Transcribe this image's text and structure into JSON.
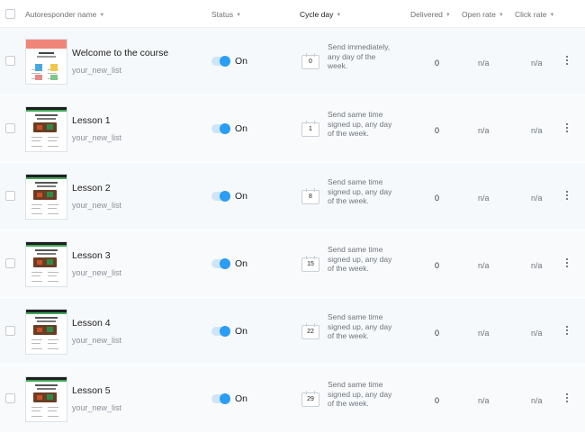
{
  "columns": {
    "name": "Autoresponder name",
    "status": "Status",
    "cycle_day": "Cycle day",
    "delivered": "Delivered",
    "open_rate": "Open rate",
    "click_rate": "Click rate"
  },
  "rows": [
    {
      "name": "Welcome to the course",
      "list": "your_new_list",
      "status": "On",
      "day": "0",
      "description": "Send immediately, any day of the week.",
      "delivered": "0",
      "open_rate": "n/a",
      "click_rate": "n/a"
    },
    {
      "name": "Lesson 1",
      "list": "your_new_list",
      "status": "On",
      "day": "1",
      "description": "Send same time signed up, any day of the week.",
      "delivered": "0",
      "open_rate": "n/a",
      "click_rate": "n/a"
    },
    {
      "name": "Lesson 2",
      "list": "your_new_list",
      "status": "On",
      "day": "8",
      "description": "Send same time signed up, any day of the week.",
      "delivered": "0",
      "open_rate": "n/a",
      "click_rate": "n/a"
    },
    {
      "name": "Lesson 3",
      "list": "your_new_list",
      "status": "On",
      "day": "15",
      "description": "Send same time signed up, any day of the week.",
      "delivered": "0",
      "open_rate": "n/a",
      "click_rate": "n/a"
    },
    {
      "name": "Lesson 4",
      "list": "your_new_list",
      "status": "On",
      "day": "22",
      "description": "Send same time signed up, any day of the week.",
      "delivered": "0",
      "open_rate": "n/a",
      "click_rate": "n/a"
    },
    {
      "name": "Lesson 5",
      "list": "your_new_list",
      "status": "On",
      "day": "29",
      "description": "Send same time signed up, any day of the week.",
      "delivered": "0",
      "open_rate": "n/a",
      "click_rate": "n/a"
    }
  ],
  "colors": {
    "toggle_on": "#2a9df4",
    "row_bg": "#f6f9fb"
  },
  "icons": {
    "sort": "caret-down-icon",
    "calendar": "calendar-icon",
    "more": "more-vertical-icon"
  }
}
